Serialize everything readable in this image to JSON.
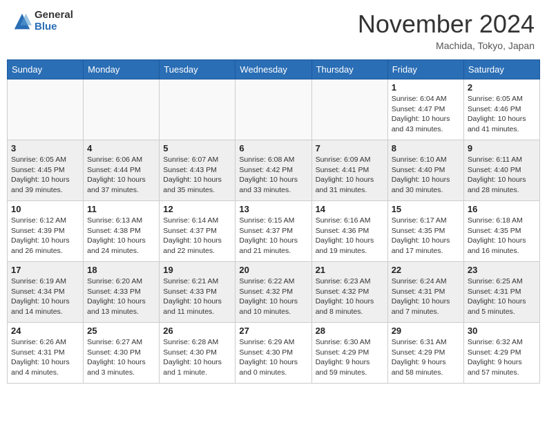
{
  "header": {
    "logo_general": "General",
    "logo_blue": "Blue",
    "month_title": "November 2024",
    "location": "Machida, Tokyo, Japan"
  },
  "weekdays": [
    "Sunday",
    "Monday",
    "Tuesday",
    "Wednesday",
    "Thursday",
    "Friday",
    "Saturday"
  ],
  "weeks": [
    [
      {
        "day": "",
        "info": ""
      },
      {
        "day": "",
        "info": ""
      },
      {
        "day": "",
        "info": ""
      },
      {
        "day": "",
        "info": ""
      },
      {
        "day": "",
        "info": ""
      },
      {
        "day": "1",
        "info": "Sunrise: 6:04 AM\nSunset: 4:47 PM\nDaylight: 10 hours and 43 minutes."
      },
      {
        "day": "2",
        "info": "Sunrise: 6:05 AM\nSunset: 4:46 PM\nDaylight: 10 hours and 41 minutes."
      }
    ],
    [
      {
        "day": "3",
        "info": "Sunrise: 6:05 AM\nSunset: 4:45 PM\nDaylight: 10 hours and 39 minutes."
      },
      {
        "day": "4",
        "info": "Sunrise: 6:06 AM\nSunset: 4:44 PM\nDaylight: 10 hours and 37 minutes."
      },
      {
        "day": "5",
        "info": "Sunrise: 6:07 AM\nSunset: 4:43 PM\nDaylight: 10 hours and 35 minutes."
      },
      {
        "day": "6",
        "info": "Sunrise: 6:08 AM\nSunset: 4:42 PM\nDaylight: 10 hours and 33 minutes."
      },
      {
        "day": "7",
        "info": "Sunrise: 6:09 AM\nSunset: 4:41 PM\nDaylight: 10 hours and 31 minutes."
      },
      {
        "day": "8",
        "info": "Sunrise: 6:10 AM\nSunset: 4:40 PM\nDaylight: 10 hours and 30 minutes."
      },
      {
        "day": "9",
        "info": "Sunrise: 6:11 AM\nSunset: 4:40 PM\nDaylight: 10 hours and 28 minutes."
      }
    ],
    [
      {
        "day": "10",
        "info": "Sunrise: 6:12 AM\nSunset: 4:39 PM\nDaylight: 10 hours and 26 minutes."
      },
      {
        "day": "11",
        "info": "Sunrise: 6:13 AM\nSunset: 4:38 PM\nDaylight: 10 hours and 24 minutes."
      },
      {
        "day": "12",
        "info": "Sunrise: 6:14 AM\nSunset: 4:37 PM\nDaylight: 10 hours and 22 minutes."
      },
      {
        "day": "13",
        "info": "Sunrise: 6:15 AM\nSunset: 4:37 PM\nDaylight: 10 hours and 21 minutes."
      },
      {
        "day": "14",
        "info": "Sunrise: 6:16 AM\nSunset: 4:36 PM\nDaylight: 10 hours and 19 minutes."
      },
      {
        "day": "15",
        "info": "Sunrise: 6:17 AM\nSunset: 4:35 PM\nDaylight: 10 hours and 17 minutes."
      },
      {
        "day": "16",
        "info": "Sunrise: 6:18 AM\nSunset: 4:35 PM\nDaylight: 10 hours and 16 minutes."
      }
    ],
    [
      {
        "day": "17",
        "info": "Sunrise: 6:19 AM\nSunset: 4:34 PM\nDaylight: 10 hours and 14 minutes."
      },
      {
        "day": "18",
        "info": "Sunrise: 6:20 AM\nSunset: 4:33 PM\nDaylight: 10 hours and 13 minutes."
      },
      {
        "day": "19",
        "info": "Sunrise: 6:21 AM\nSunset: 4:33 PM\nDaylight: 10 hours and 11 minutes."
      },
      {
        "day": "20",
        "info": "Sunrise: 6:22 AM\nSunset: 4:32 PM\nDaylight: 10 hours and 10 minutes."
      },
      {
        "day": "21",
        "info": "Sunrise: 6:23 AM\nSunset: 4:32 PM\nDaylight: 10 hours and 8 minutes."
      },
      {
        "day": "22",
        "info": "Sunrise: 6:24 AM\nSunset: 4:31 PM\nDaylight: 10 hours and 7 minutes."
      },
      {
        "day": "23",
        "info": "Sunrise: 6:25 AM\nSunset: 4:31 PM\nDaylight: 10 hours and 5 minutes."
      }
    ],
    [
      {
        "day": "24",
        "info": "Sunrise: 6:26 AM\nSunset: 4:31 PM\nDaylight: 10 hours and 4 minutes."
      },
      {
        "day": "25",
        "info": "Sunrise: 6:27 AM\nSunset: 4:30 PM\nDaylight: 10 hours and 3 minutes."
      },
      {
        "day": "26",
        "info": "Sunrise: 6:28 AM\nSunset: 4:30 PM\nDaylight: 10 hours and 1 minute."
      },
      {
        "day": "27",
        "info": "Sunrise: 6:29 AM\nSunset: 4:30 PM\nDaylight: 10 hours and 0 minutes."
      },
      {
        "day": "28",
        "info": "Sunrise: 6:30 AM\nSunset: 4:29 PM\nDaylight: 9 hours and 59 minutes."
      },
      {
        "day": "29",
        "info": "Sunrise: 6:31 AM\nSunset: 4:29 PM\nDaylight: 9 hours and 58 minutes."
      },
      {
        "day": "30",
        "info": "Sunrise: 6:32 AM\nSunset: 4:29 PM\nDaylight: 9 hours and 57 minutes."
      }
    ]
  ]
}
